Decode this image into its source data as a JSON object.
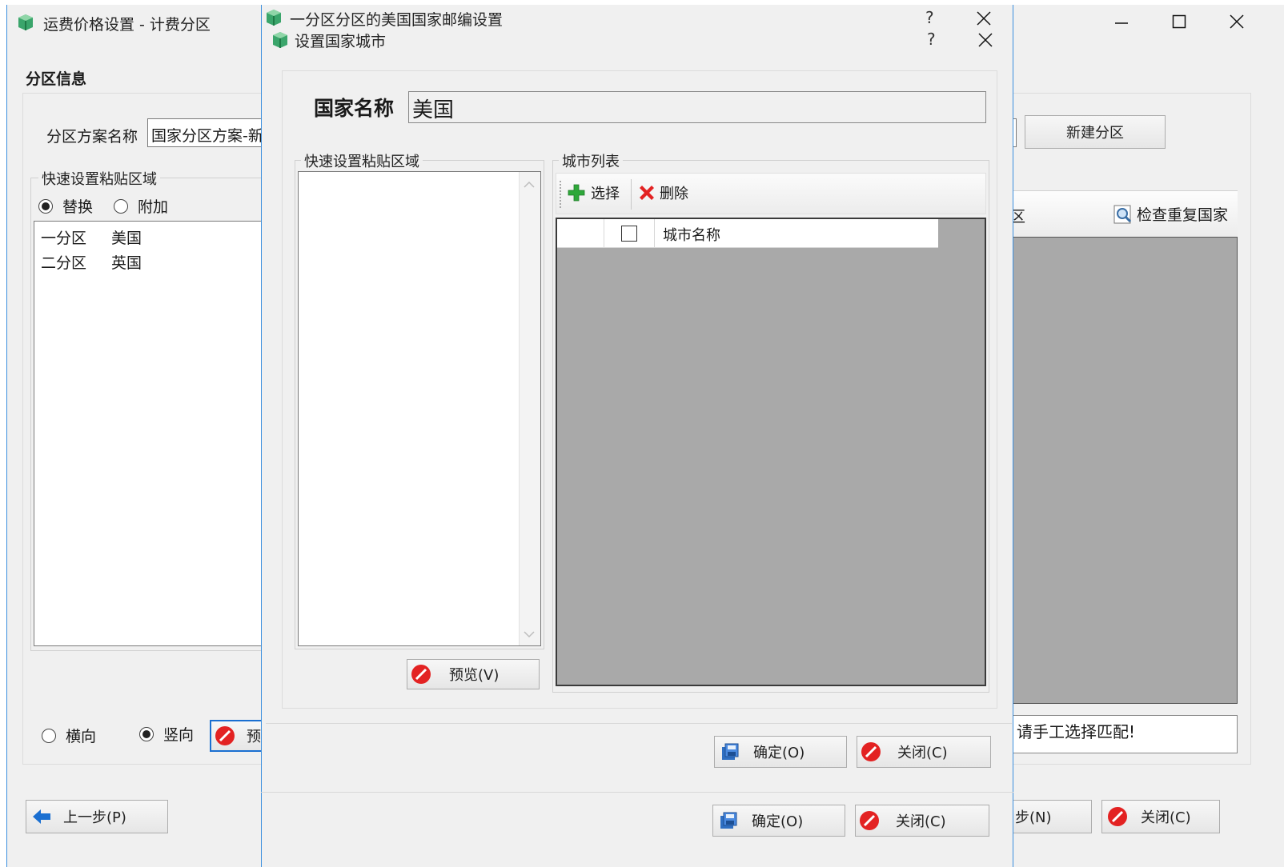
{
  "main_window": {
    "title": "运费价格设置 - 计费分区",
    "section_title": "分区信息",
    "scheme_label": "分区方案名称",
    "scheme_value": "国家分区方案-新",
    "paste_group_label": "快速设置粘贴区域",
    "radio_replace": "替换",
    "radio_append": "附加",
    "list_rows": [
      {
        "zone": "一分区",
        "country": "美国"
      },
      {
        "zone": "二分区",
        "country": "英国"
      }
    ],
    "radio_horizontal": "横向",
    "radio_vertical": "竖向",
    "preview_partial": "预",
    "new_zone_button": "新建分区",
    "zone_header_partial": "区",
    "check_duplicate_button": "检查重复国家",
    "hint_text": "请手工选择匹配!",
    "prev_button": "上一步(P)",
    "next_button_partial": "步(N)",
    "close_button": "关闭(C)"
  },
  "mid_dialog": {
    "title": "一分区分区的美国国家邮编设置",
    "ok_button": "确定(O)",
    "close_button": "关闭(C)"
  },
  "city_dialog": {
    "title": "设置国家城市",
    "country_label": "国家名称",
    "country_value": "美国",
    "paste_group_label": "快速设置粘贴区域",
    "preview_button": "预览(V)",
    "city_group_label": "城市列表",
    "select_button": "选择",
    "delete_button": "删除",
    "column_city_name": "城市名称",
    "ok_button": "确定(O)",
    "close_button": "关闭(C)"
  },
  "system": {
    "help": "?",
    "close": "×",
    "minimize": "—",
    "maximize": "☐"
  },
  "colors": {
    "window_bg": "#f0f0f0",
    "grid_bg": "#a9a9a9",
    "accent_blue": "#1a6fd1",
    "stop_red": "#e32222",
    "add_green": "#2ea83a"
  }
}
